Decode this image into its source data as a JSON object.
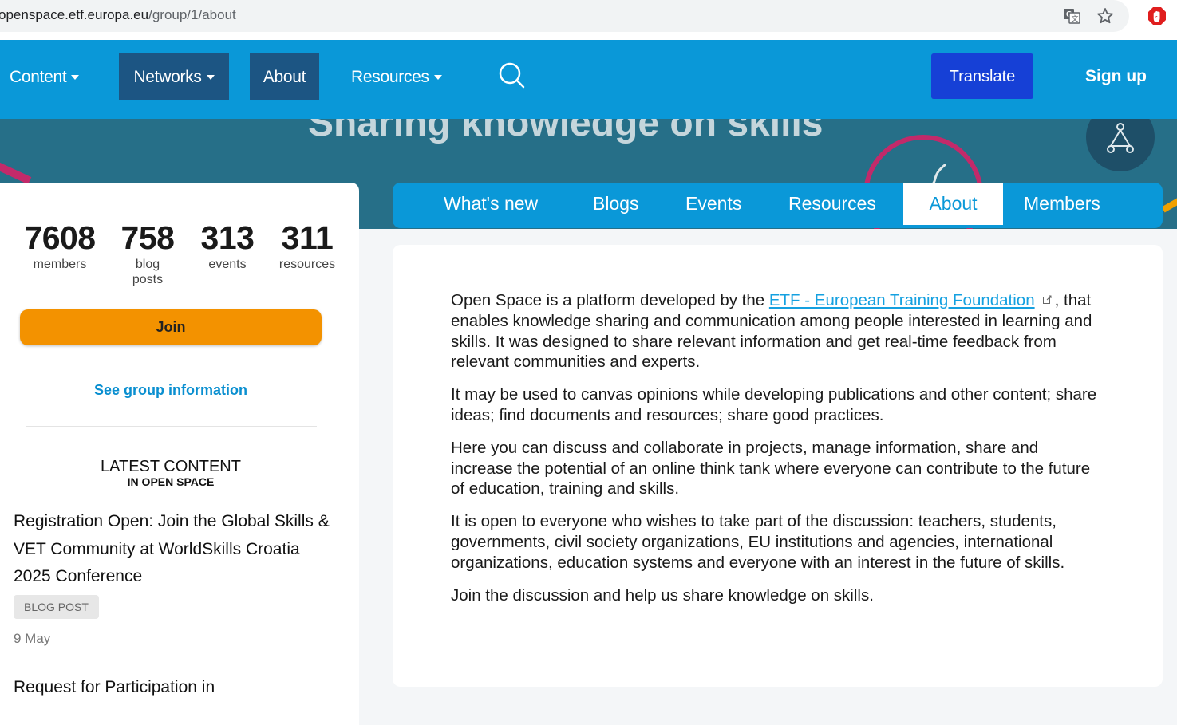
{
  "browser": {
    "url_domain": "openspace.etf.europa.eu",
    "url_path": "/group/1/about",
    "icons": [
      "translate-icon",
      "star-icon",
      "extension-icon"
    ]
  },
  "nav": {
    "items": [
      {
        "label": "Content",
        "has_caret": true
      },
      {
        "label": "Networks",
        "has_caret": true
      },
      {
        "label": "About",
        "has_caret": false
      },
      {
        "label": "Resources",
        "has_caret": true
      }
    ],
    "translate_label": "Translate",
    "signup_label": "Sign up",
    "colors": {
      "bar": "#0a98d8",
      "active": "#1c5583",
      "translate": "#1640d6"
    }
  },
  "banner": {
    "title": "Sharing knowledge on skills"
  },
  "stats": [
    {
      "value": "7608",
      "label": "members"
    },
    {
      "value": "758",
      "label": "blog posts"
    },
    {
      "value": "313",
      "label": "events"
    },
    {
      "value": "311",
      "label": "resources"
    }
  ],
  "sidebar": {
    "join_label": "Join",
    "group_info_label": "See group information",
    "latest_title": "LATEST CONTENT",
    "latest_subtitle": "IN OPEN SPACE",
    "posts": [
      {
        "title": "Registration Open: Join the Global Skills & VET Community at WorldSkills Croatia 2025 Conference",
        "badge": "BLOG POST",
        "date": "9 May"
      },
      {
        "title": "Request for Participation in"
      }
    ]
  },
  "tabs": [
    {
      "label": "What's new"
    },
    {
      "label": "Blogs"
    },
    {
      "label": "Events"
    },
    {
      "label": "Resources"
    },
    {
      "label": "About",
      "active": true
    },
    {
      "label": "Members"
    }
  ],
  "about": {
    "p1_before": "Open Space is a platform developed by the ",
    "p1_link": "ETF - European Training Foundation",
    "p1_after": ", that enables knowledge sharing and communication among people interested in learning and skills. It was designed to share relevant information and get real-time feedback from relevant communities and experts.",
    "p2": "It may be used to canvas opinions while developing publications and other content; share ideas; find documents and resources; share good practices.",
    "p3": "Here you can discuss and collaborate in projects, manage information, share and increase the potential of an online think tank where everyone can contribute to the future of education, training and skills.",
    "p4": "It is open to everyone who wishes to take part of the discussion: teachers, students, governments, civil society organizations, EU institutions and agencies, international organizations, education systems and everyone with an interest in the future of skills.",
    "p5": "Join the discussion and help us share knowledge on skills."
  }
}
